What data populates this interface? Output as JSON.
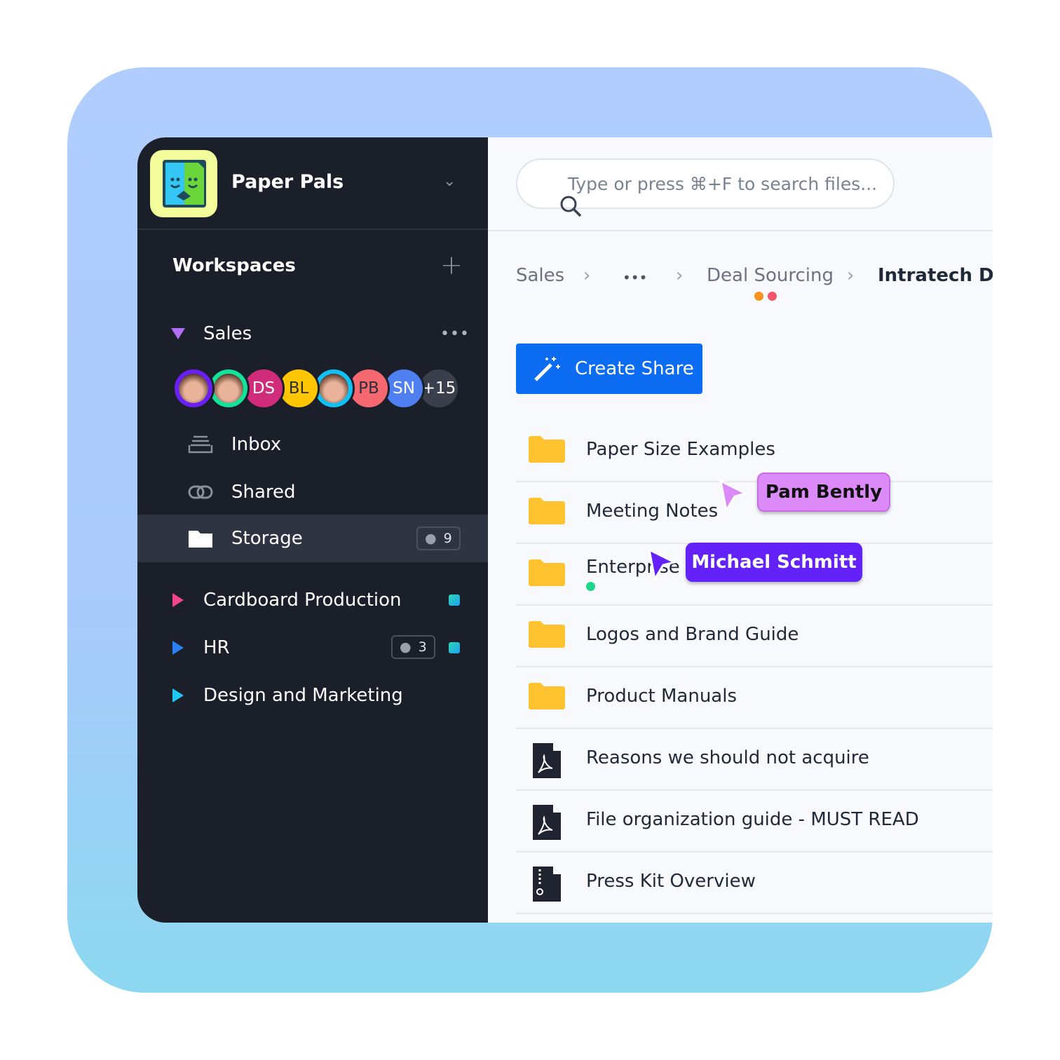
{
  "app": {
    "name": "Paper Pals"
  },
  "sidebar": {
    "workspaces_label": "Workspaces",
    "sales": {
      "label": "Sales",
      "members": [
        {
          "type": "photo",
          "ring": "#6a1ff5"
        },
        {
          "type": "photo",
          "ring": "#12e39a"
        },
        {
          "type": "initials",
          "text": "DS",
          "color": "#d12c7c"
        },
        {
          "type": "initials",
          "text": "BL",
          "color": "#fdc600"
        },
        {
          "type": "photo",
          "ring": "#0fc1f5"
        },
        {
          "type": "initials",
          "text": "PB",
          "color": "#f56870"
        },
        {
          "type": "initials",
          "text": "SN",
          "color": "#4f7ff0"
        },
        {
          "type": "more",
          "text": "+15",
          "color": "#3a3f4b"
        }
      ]
    },
    "items": [
      {
        "label": "Inbox",
        "icon": "inbox-icon"
      },
      {
        "label": "Shared",
        "icon": "link-icon"
      },
      {
        "label": "Storage",
        "icon": "folder-icon",
        "members": "9",
        "active": true
      }
    ],
    "workspaces": [
      {
        "label": "Cardboard Production",
        "color": "#f0468c"
      },
      {
        "label": "HR",
        "color": "#2b7ff3",
        "members": "3"
      },
      {
        "label": "Design and Marketing",
        "color": "#1fc8f0"
      }
    ]
  },
  "search": {
    "placeholder": "Type or press ⌘+F to search files..."
  },
  "breadcrumb": [
    "Sales",
    "•••",
    "Deal Sourcing",
    "Intratech De"
  ],
  "create_share": "Create Share",
  "files": [
    {
      "name": "Paper Size Examples",
      "type": "folder"
    },
    {
      "name": "Meeting Notes",
      "type": "folder"
    },
    {
      "name": "Enterprise S",
      "type": "folder"
    },
    {
      "name": "Logos and Brand Guide",
      "type": "folder"
    },
    {
      "name": "Product Manuals",
      "type": "folder"
    },
    {
      "name": "Reasons we should not acquire",
      "type": "pdf"
    },
    {
      "name": "File organization guide - MUST READ",
      "type": "pdf"
    },
    {
      "name": "Press Kit Overview",
      "type": "zip"
    }
  ],
  "cursors": [
    {
      "name": "Pam Bently",
      "color": "#dc8af7"
    },
    {
      "name": "Michael Schmitt",
      "color": "#6422fb"
    }
  ]
}
